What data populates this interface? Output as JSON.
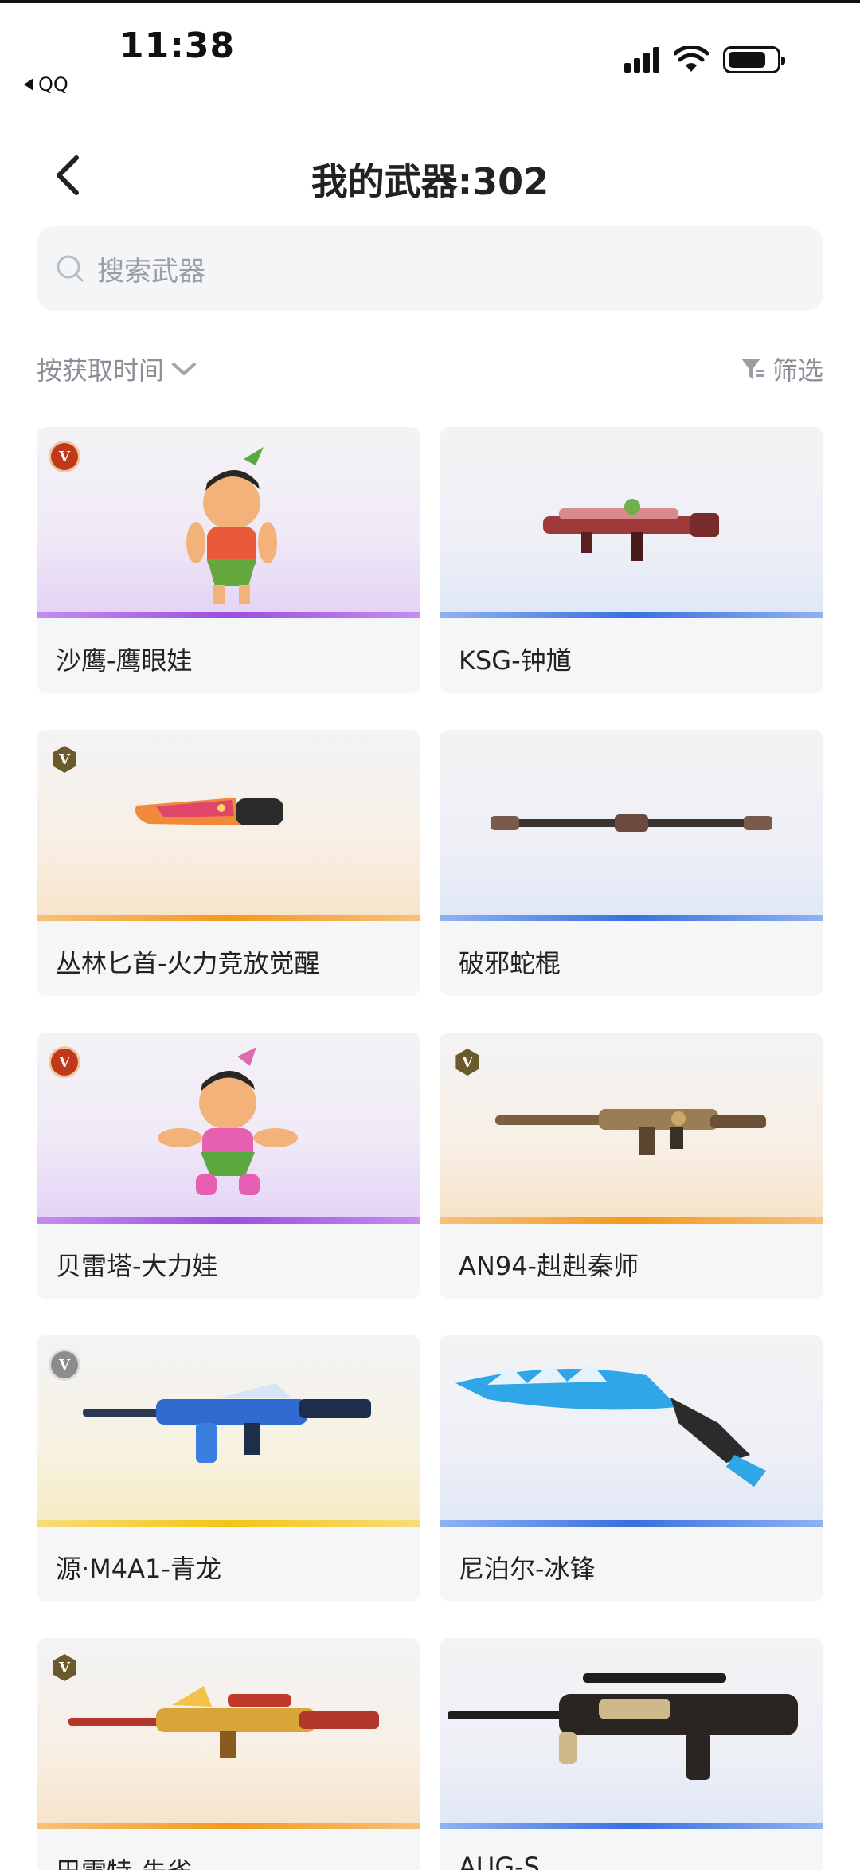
{
  "status_bar": {
    "time": "11:38",
    "back_app": "QQ"
  },
  "nav": {
    "title": "我的武器:302"
  },
  "search": {
    "placeholder": "搜索武器"
  },
  "sort": {
    "label": "按获取时间"
  },
  "filter": {
    "label": "筛选"
  },
  "weapons": [
    {
      "name": "沙鹰-鹰眼娃",
      "badge": "red",
      "badge_letter": "V",
      "rarity_color": "purple"
    },
    {
      "name": "KSG-钟馗",
      "badge": "",
      "badge_letter": "",
      "rarity_color": "blue"
    },
    {
      "name": "丛林匕首-火力竞放觉醒",
      "badge": "gold",
      "badge_letter": "V",
      "rarity_color": "orange"
    },
    {
      "name": "破邪蛇棍",
      "badge": "",
      "badge_letter": "",
      "rarity_color": "blue"
    },
    {
      "name": "贝雷塔-大力娃",
      "badge": "red",
      "badge_letter": "V",
      "rarity_color": "purple"
    },
    {
      "name": "AN94-赳赳秦师",
      "badge": "gold",
      "badge_letter": "V",
      "rarity_color": "orange"
    },
    {
      "name": "源·M4A1-青龙",
      "badge": "silver",
      "badge_letter": "V",
      "rarity_color": "yellow"
    },
    {
      "name": "尼泊尔-冰锋",
      "badge": "",
      "badge_letter": "",
      "rarity_color": "blue"
    },
    {
      "name": "巴雷特-朱雀",
      "badge": "gold",
      "badge_letter": "V",
      "rarity_color": "orange"
    },
    {
      "name": "AUG-S",
      "badge": "",
      "badge_letter": "",
      "rarity_color": "blue"
    }
  ]
}
